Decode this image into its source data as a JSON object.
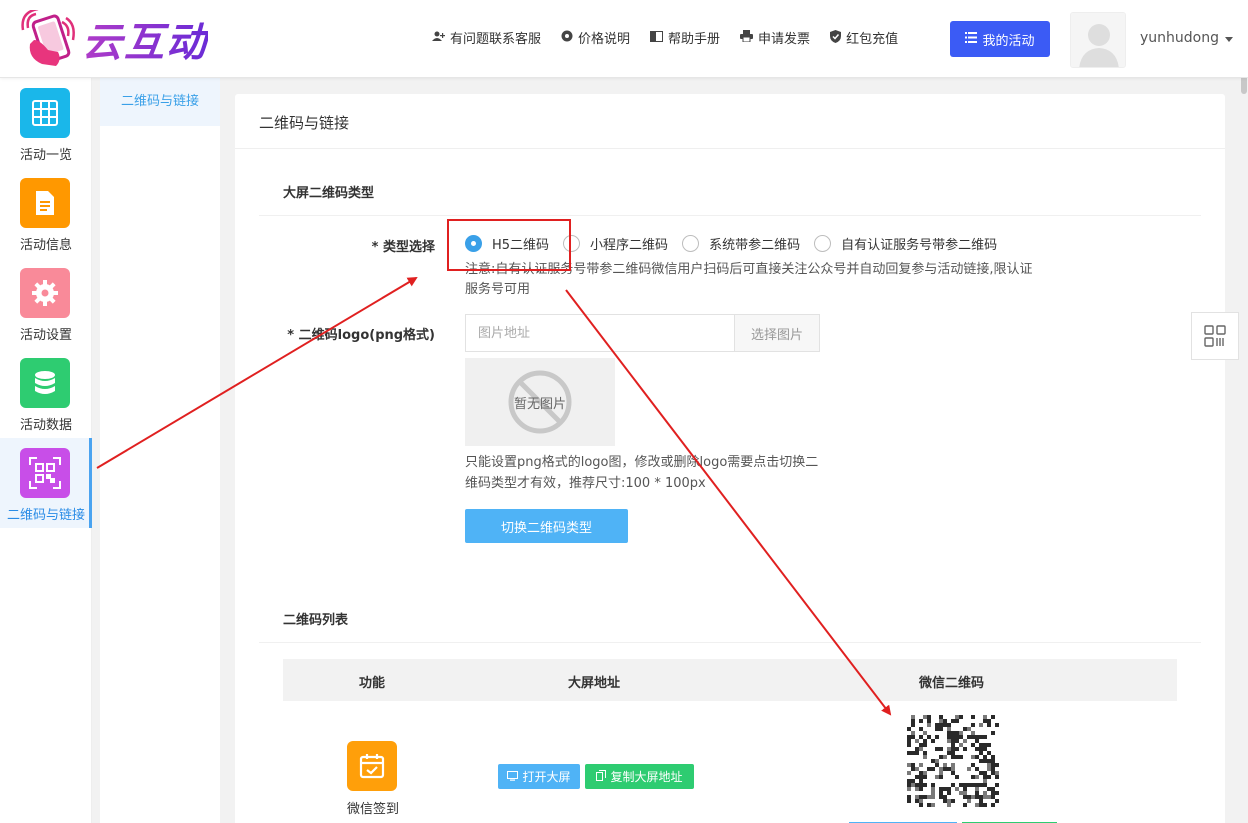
{
  "brand": {
    "name": "云互动"
  },
  "topnav": [
    {
      "icon": "user-plus-icon",
      "label": "有问题联系客服"
    },
    {
      "icon": "gear-icon",
      "label": "价格说明"
    },
    {
      "icon": "book-icon",
      "label": "帮助手册"
    },
    {
      "icon": "printer-icon",
      "label": "申请发票"
    },
    {
      "icon": "shield-check-icon",
      "label": "红包充值"
    }
  ],
  "my_activity_button": "我的活动",
  "user": {
    "name": "yunhudong"
  },
  "sidebar": {
    "items": [
      {
        "label": "活动一览",
        "icon": "grid-icon",
        "color": "#1ab7ea"
      },
      {
        "label": "活动信息",
        "icon": "document-icon",
        "color": "#ff9800"
      },
      {
        "label": "活动设置",
        "icon": "gear-icon",
        "color": "#f98a99"
      },
      {
        "label": "活动数据",
        "icon": "database-icon",
        "color": "#2ecc71"
      },
      {
        "label": "二维码与链接",
        "icon": "qrcode-icon",
        "color": "#c84ee8"
      }
    ]
  },
  "submenu": {
    "items": [
      "二维码与链接"
    ]
  },
  "page": {
    "title": "二维码与链接",
    "section_qr_type": "大屏二维码类型",
    "type_label": "类型选择",
    "type_options": [
      "H5二维码",
      "小程序二维码",
      "系统带参二维码",
      "自有认证服务号带参二维码"
    ],
    "type_selected": "H5二维码",
    "type_note": "注意:自有认证服务号带参二维码微信用户扫码后可直接关注公众号并自动回复参与活动链接,限认证服务号可用",
    "logo_label": "二维码logo(png格式)",
    "logo_placeholder": "图片地址",
    "pick_image": "选择图片",
    "no_image": "暂无图片",
    "logo_hint": "只能设置png格式的logo图，修改或删除logo需要点击切换二维码类型才有效，推荐尺寸:100 * 100px",
    "switch_button": "切换二维码类型",
    "section_list": "二维码列表",
    "table": {
      "headers": [
        "功能",
        "大屏地址",
        "微信二维码"
      ],
      "rows": [
        {
          "name": "微信签到",
          "open_screen": "打开大屏",
          "copy_screen": "复制大屏地址"
        }
      ]
    }
  },
  "colors": {
    "primary": "#3b5bf5",
    "accent": "#4fb3f6",
    "annotation": "#e02020"
  }
}
